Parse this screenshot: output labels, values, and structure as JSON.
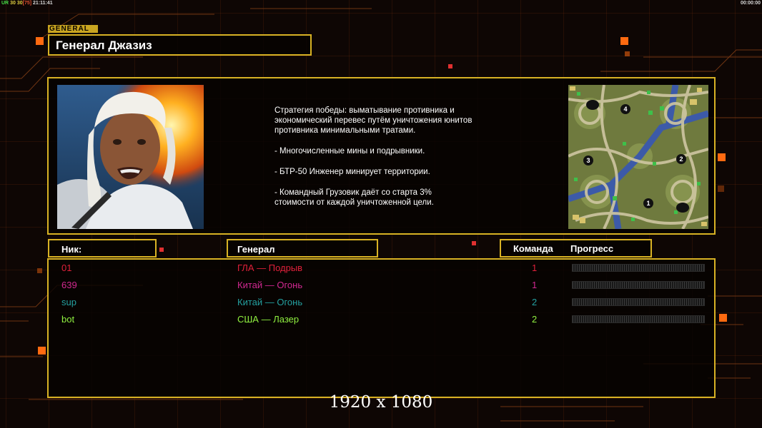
{
  "status_bar": {
    "left_a": "UR",
    "left_b": "30",
    "left_c": "30",
    "left_d": "[75]",
    "left_time": "21:11:41",
    "right_time": "00:00:00"
  },
  "section_tag": "GENERAL",
  "general_name": "Генерал Джазиз",
  "description": [
    "Стратегия победы: выматывание противника и\n экономический перевес путём уничтожения юнитов\n противника минимальными тратами.",
    "- Многочисленные мины и подрывники.",
    "- БТР-50 Инженер минирует территории.",
    "- Командный Грузовик даёт со старта 3%\n стоимости от каждой уничтоженной цели."
  ],
  "headers": {
    "nick": "Ник:",
    "general": "Генерал",
    "team": "Команда",
    "progress": "Прогресс"
  },
  "players": [
    {
      "nick": "01",
      "general": "ГЛА — Подрыв",
      "team": "1",
      "color": "#e0203a",
      "progress": 0
    },
    {
      "nick": "639",
      "general": "Китай — Огонь",
      "team": "1",
      "color": "#d02890",
      "progress": 0
    },
    {
      "nick": "sup",
      "general": "Китай — Огонь",
      "team": "2",
      "color": "#24a0a0",
      "progress": 0
    },
    {
      "nick": "bot",
      "general": "США — Лазер",
      "team": "2",
      "color": "#90f040",
      "progress": 0
    }
  ],
  "minimap_start_positions": [
    "4",
    "3",
    "2",
    "1"
  ],
  "resolution_label": "1920 x 1080",
  "colors": {
    "frame": "#d8b224",
    "accent_orange": "#ff6a10",
    "background": "#0e0604"
  }
}
